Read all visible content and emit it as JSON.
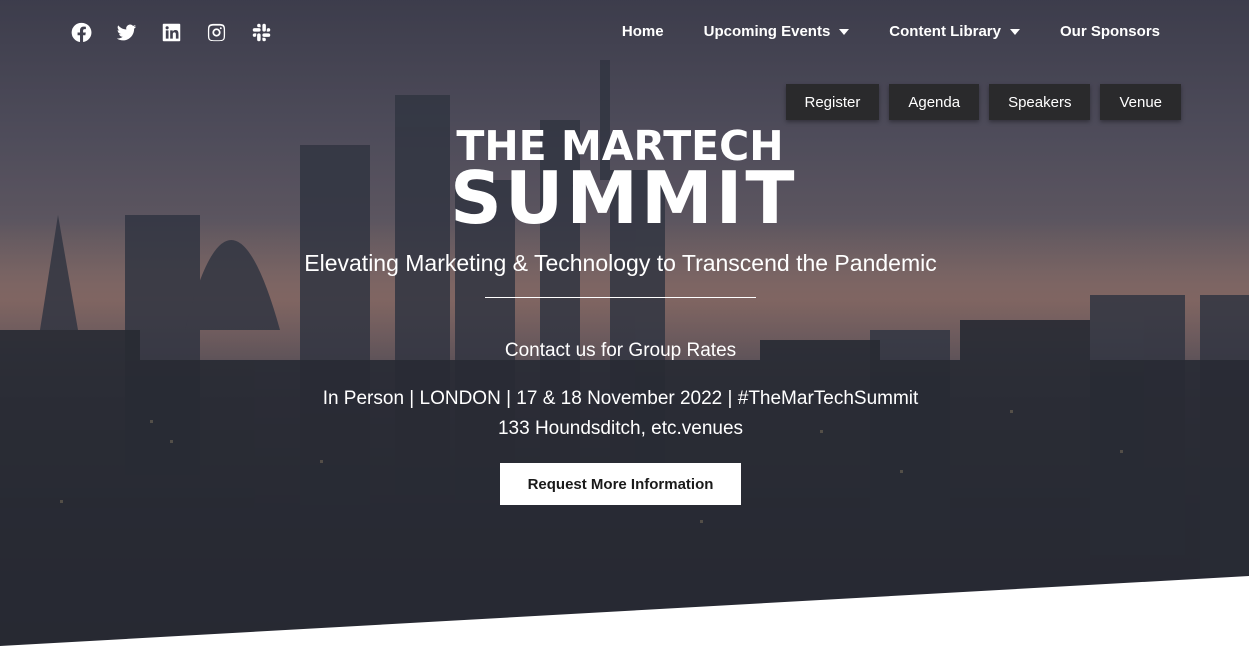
{
  "social": {
    "icons": [
      "facebook-icon",
      "twitter-icon",
      "linkedin-icon",
      "instagram-icon",
      "slack-icon"
    ]
  },
  "nav": {
    "home": "Home",
    "upcoming_events": "Upcoming Events",
    "content_library": "Content Library",
    "our_sponsors": "Our Sponsors"
  },
  "subnav": {
    "register": "Register",
    "agenda": "Agenda",
    "speakers": "Speakers",
    "venue": "Venue"
  },
  "logo": {
    "line1": "THE MARTECH",
    "line2": "SUMMIT"
  },
  "hero": {
    "tagline": "Elevating Marketing & Technology to Transcend the Pandemic",
    "contact": "Contact us for Group Rates",
    "event_line": "In Person | LONDON | 17 & 18 November 2022 | #TheMarTechSummit",
    "venue_line": "133 Houndsditch, etc.venues",
    "cta_label": "Request More Information"
  },
  "colors": {
    "text": "#ffffff",
    "subnav_bg": "#2a2a2c",
    "cta_bg": "#ffffff",
    "cta_text": "#1a1a1a"
  }
}
